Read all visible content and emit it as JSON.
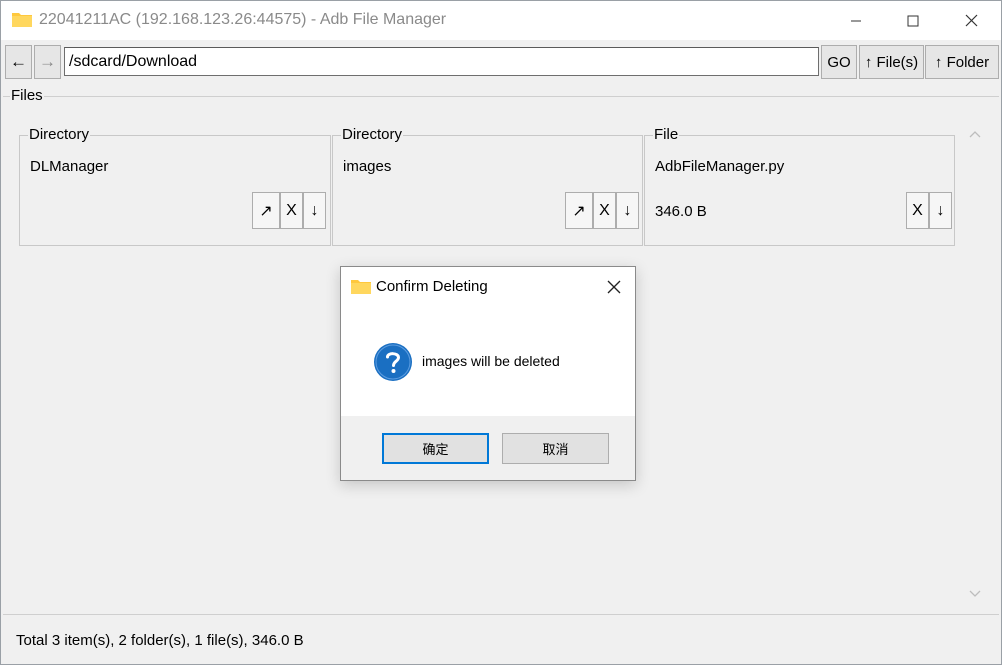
{
  "window": {
    "title": "22041211AC (192.168.123.26:44575) - Adb File Manager",
    "icons": {
      "app": "folder-icon",
      "minimize": "minimize-icon",
      "maximize": "maximize-icon",
      "close": "close-icon"
    }
  },
  "toolbar": {
    "back_label": "←",
    "forward_label": "→",
    "path_value": "/sdcard/Download",
    "go_label": "GO",
    "upload_files_label": "↑ File(s)",
    "upload_folder_label": "↑ Folder"
  },
  "files": {
    "group_label": "Files",
    "items": [
      {
        "type": "Directory",
        "name": "DLManager",
        "size": "",
        "open_label": "↗",
        "delete_label": "X",
        "download_label": "↓"
      },
      {
        "type": "Directory",
        "name": "images",
        "size": "",
        "open_label": "↗",
        "delete_label": "X",
        "download_label": "↓"
      },
      {
        "type": "File",
        "name": "AdbFileManager.py",
        "size": "346.0 B",
        "delete_label": "X",
        "download_label": "↓"
      }
    ]
  },
  "status": {
    "text": "Total 3 item(s), 2 folder(s), 1 file(s), 346.0 B"
  },
  "dialog": {
    "title": "Confirm Deleting",
    "message": "images will be deleted",
    "ok_label": "确定",
    "cancel_label": "取消",
    "icon": "question-icon"
  },
  "colors": {
    "folder": "#ffc83d",
    "question": "#1a6fc2",
    "accent": "#0078d7"
  }
}
